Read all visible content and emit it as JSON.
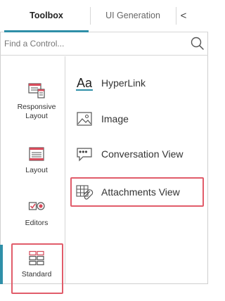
{
  "tabs": [
    {
      "label": "Toolbox"
    },
    {
      "label": "UI Generation"
    },
    {
      "label": "<"
    }
  ],
  "search": {
    "placeholder": "Find a Control..."
  },
  "categories": [
    {
      "label_line1": "Responsive",
      "label_line2": "Layout",
      "icon": "responsive-layout-icon"
    },
    {
      "label": "Layout",
      "icon": "layout-icon"
    },
    {
      "label": "Editors",
      "icon": "editors-icon"
    },
    {
      "label": "Standard",
      "icon": "standard-icon"
    }
  ],
  "controls": [
    {
      "label": "HyperLink",
      "icon": "hyperlink-icon",
      "icon_text": "Aa"
    },
    {
      "label": "Image",
      "icon": "image-icon"
    },
    {
      "label": "Conversation View",
      "icon": "conversation-view-icon",
      "icon_text": "•••"
    },
    {
      "label": "Attachments View",
      "icon": "attachments-view-icon"
    }
  ],
  "colors": {
    "accent": "#2f8fa8",
    "highlight": "#e15c6a",
    "icon_red": "#d64a5a"
  }
}
